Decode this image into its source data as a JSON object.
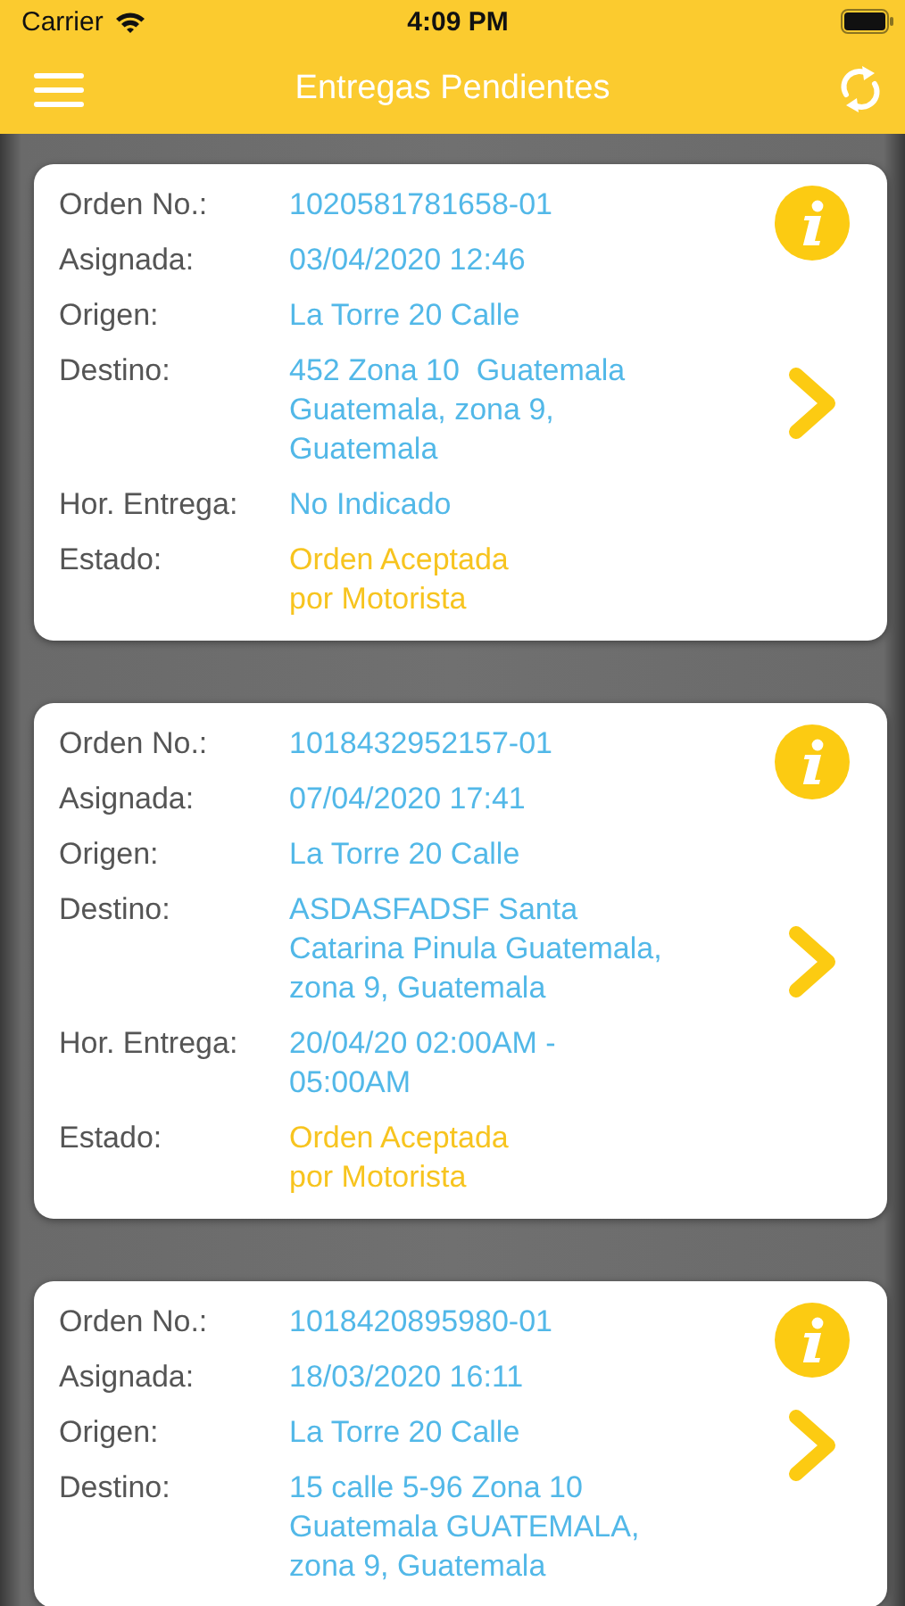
{
  "status_bar": {
    "carrier": "Carrier",
    "time": "4:09 PM"
  },
  "nav_bar": {
    "title": "Entregas Pendientes"
  },
  "orders": [
    {
      "fields": [
        {
          "label": "Orden No.:",
          "kind": "info",
          "lines": [
            "1020581781658-01"
          ]
        },
        {
          "label": "Asignada:",
          "kind": "info",
          "lines": [
            "03/04/2020 12:46"
          ]
        },
        {
          "label": "Origen:",
          "kind": "info",
          "lines": [
            "La Torre 20 Calle"
          ]
        },
        {
          "label": "Destino:",
          "kind": "info",
          "lines": [
            "452 Zona 10  Guatemala",
            "Guatemala, zona 9,",
            "Guatemala"
          ]
        },
        {
          "label": "Hor. Entrega:",
          "kind": "info",
          "lines": [
            "No Indicado"
          ]
        },
        {
          "label": "Estado:",
          "kind": "status",
          "lines": [
            "Orden Aceptada",
            "por Motorista"
          ]
        }
      ]
    },
    {
      "fields": [
        {
          "label": "Orden No.:",
          "kind": "info",
          "lines": [
            "1018432952157-01"
          ]
        },
        {
          "label": "Asignada:",
          "kind": "info",
          "lines": [
            "07/04/2020 17:41"
          ]
        },
        {
          "label": "Origen:",
          "kind": "info",
          "lines": [
            "La Torre 20 Calle"
          ]
        },
        {
          "label": "Destino:",
          "kind": "info",
          "lines": [
            "ASDASFADSF Santa",
            "Catarina Pinula Guatemala,",
            "zona 9, Guatemala"
          ]
        },
        {
          "label": "Hor. Entrega:",
          "kind": "info",
          "lines": [
            "20/04/20 02:00AM -",
            "05:00AM"
          ]
        },
        {
          "label": "Estado:",
          "kind": "status",
          "lines": [
            "Orden Aceptada",
            "por Motorista"
          ]
        }
      ]
    },
    {
      "fields": [
        {
          "label": "Orden No.:",
          "kind": "info",
          "lines": [
            "1018420895980-01"
          ]
        },
        {
          "label": "Asignada:",
          "kind": "info",
          "lines": [
            "18/03/2020 16:11"
          ]
        },
        {
          "label": "Origen:",
          "kind": "info",
          "lines": [
            "La Torre 20 Calle"
          ]
        },
        {
          "label": "Destino:",
          "kind": "info",
          "lines": [
            "15 calle 5-96 Zona 10",
            "Guatemala GUATEMALA,",
            "zona 9, Guatemala"
          ]
        }
      ]
    }
  ]
}
